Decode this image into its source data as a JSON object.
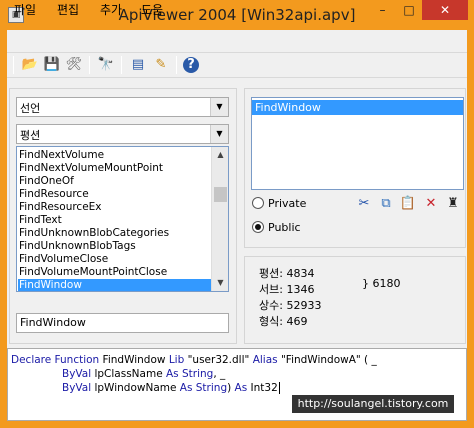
{
  "window": {
    "title": "ApiViewer 2004 [Win32api.apv]",
    "accent_color": "#f39a1e",
    "close_label": "✕",
    "min_label": "–",
    "max_label": "□"
  },
  "menu": [
    "파일",
    "편집",
    "추가",
    "도움"
  ],
  "toolbar": {
    "icons": [
      "open-folder-icon",
      "save-icon",
      "tools-icon",
      "find-icon",
      "list-icon",
      "notes-icon",
      "help-icon"
    ],
    "glyphs": [
      "📂",
      "💾",
      "🛠",
      "🔭",
      "▤",
      "✎",
      "?"
    ]
  },
  "left": {
    "declaration_combo": "선언",
    "constant_combo": "평션",
    "list_items": [
      "FindNextVolume",
      "FindNextVolumeMountPoint",
      "FindOneOf",
      "FindResource",
      "FindResourceEx",
      "FindText",
      "FindUnknownBlobCategories",
      "FindUnknownBlobTags",
      "FindVolumeClose",
      "FindVolumeMountPointClose",
      "FindWindow"
    ],
    "selected_item": "FindWindow",
    "search_value": "FindWindow"
  },
  "right": {
    "selected_list": [
      "FindWindow"
    ],
    "radio_private": "Private",
    "radio_public": "Public",
    "public_selected": true,
    "tool_glyphs": [
      "✂",
      "⧉",
      "📋",
      "✕",
      "♜"
    ],
    "stats": [
      {
        "label": "평션:",
        "value": "4834"
      },
      {
        "label": "서브:",
        "value": "1346"
      },
      {
        "label": "상수:",
        "value": "52933"
      },
      {
        "label": "형식:",
        "value": "469"
      }
    ],
    "extra": "} 6180"
  },
  "code": {
    "line1_kw1": "Declare Function",
    "line1_rest": " FindWindow ",
    "line1_kw2": "Lib",
    "line1_str": " \"user32.dll\" ",
    "line1_kw3": "Alias",
    "line1_end": " \"FindWindowA\" ( _",
    "line2_kw1": "ByVal",
    "line2_rest": " lpClassName ",
    "line2_kw2": "As String",
    "line2_end": ", _",
    "line3_kw1": "ByVal",
    "line3_rest": " lpWindowName ",
    "line3_kw2": "As String",
    "line3_mid": ") ",
    "line3_kw3": "As",
    "line3_end": " Int32"
  },
  "watermark": "http://soulangel.tistory.com"
}
